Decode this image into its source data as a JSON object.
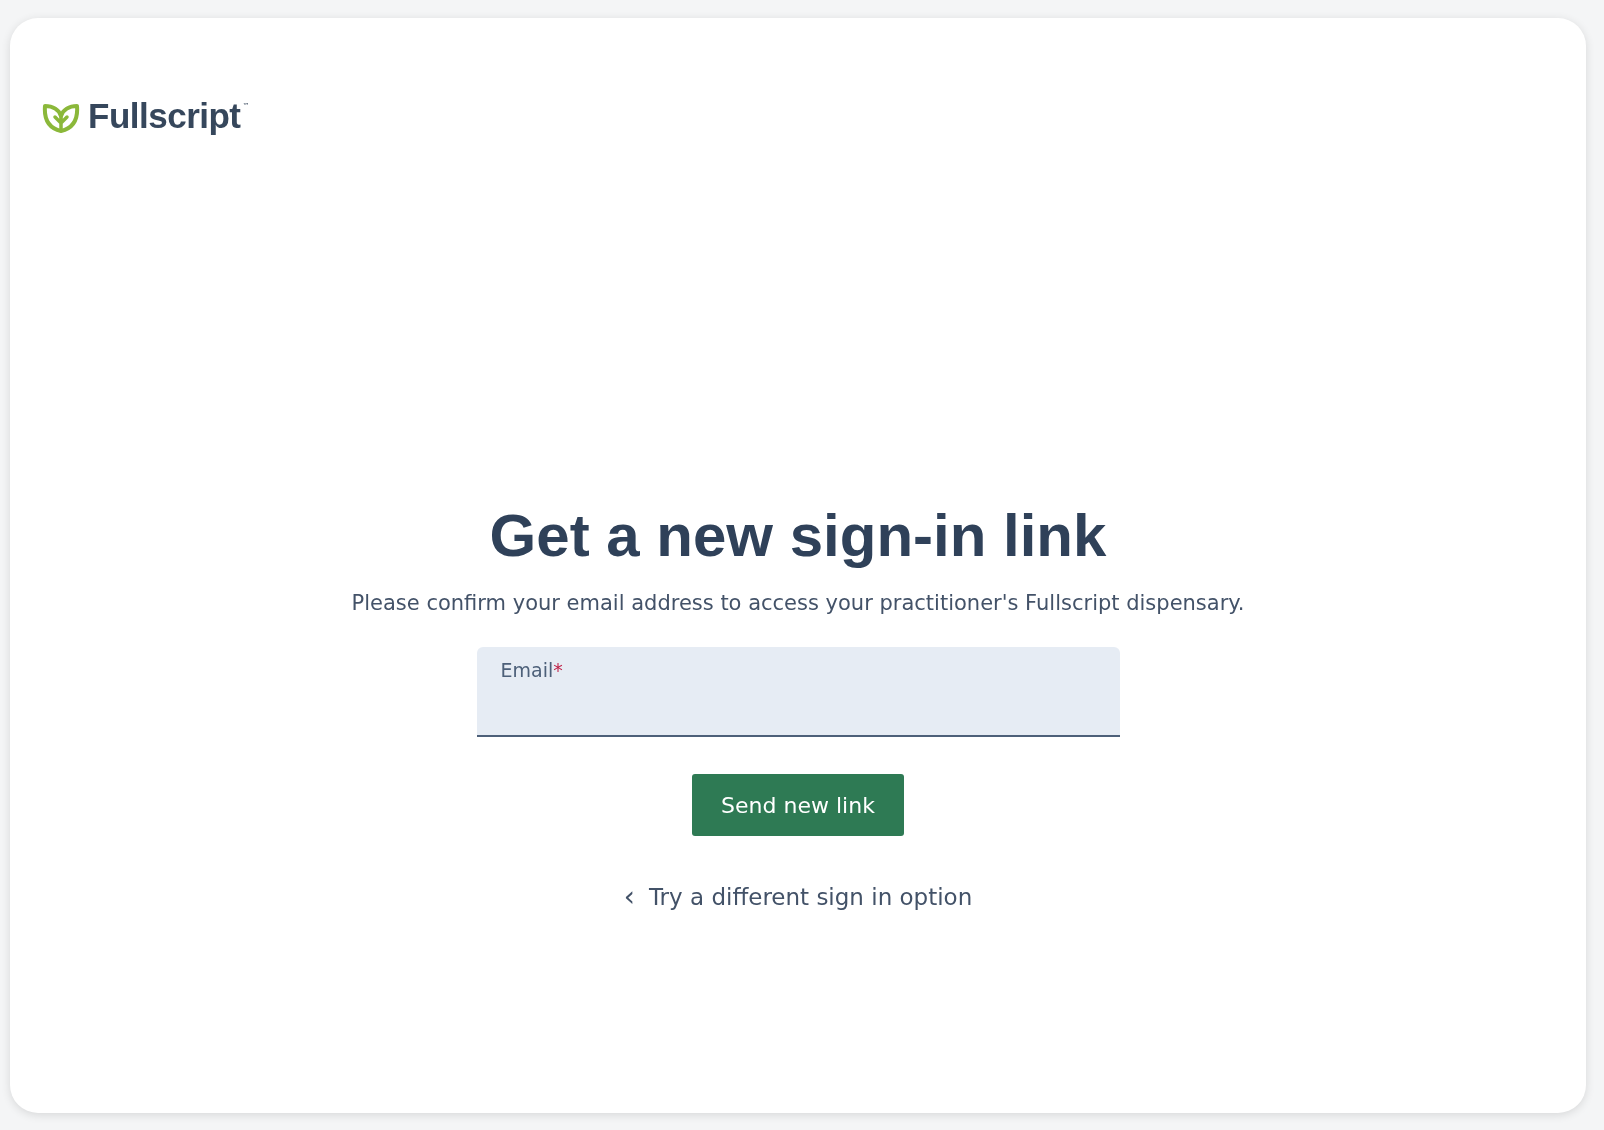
{
  "logo": {
    "name": "Fullscript",
    "trademark": "™"
  },
  "heading": "Get a new sign-in link",
  "description": "Please confirm your email address to access your practitioner's Fullscript dispensary.",
  "email_field": {
    "label": "Email",
    "required_mark": "*"
  },
  "submit_button": "Send new link",
  "back_link": {
    "icon": "‹",
    "label": "Try a different sign in option"
  }
}
